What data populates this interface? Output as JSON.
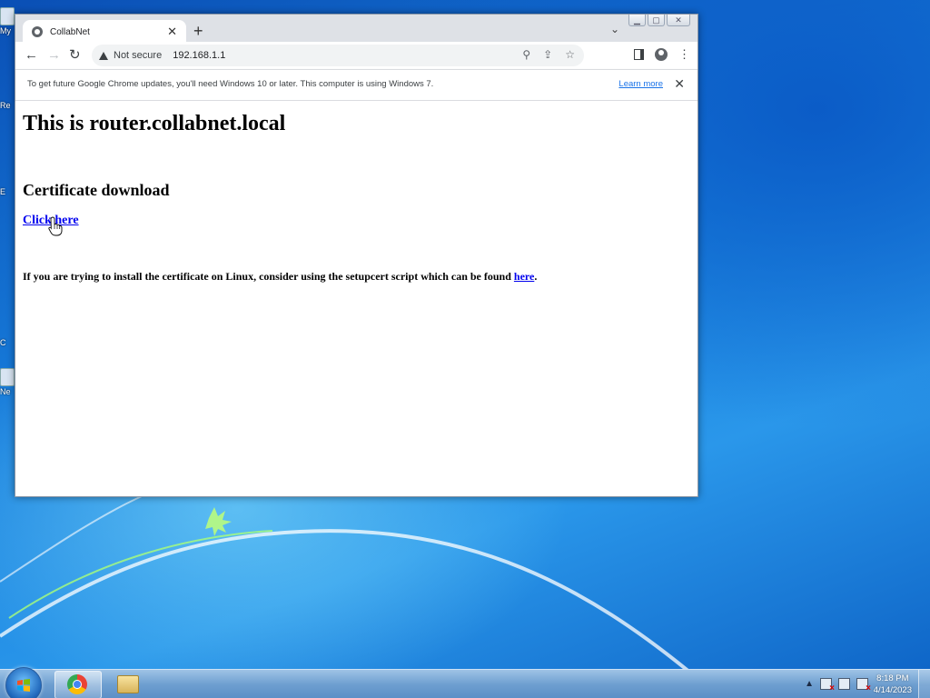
{
  "desktop": {
    "icons": [
      {
        "label": "My"
      },
      {
        "label": "Re"
      },
      {
        "label": "E"
      },
      {
        "label": "C"
      },
      {
        "label": "Ne"
      }
    ]
  },
  "browser": {
    "tab": {
      "title": "CollabNet"
    },
    "address": {
      "security_label": "Not secure",
      "host": "192.168.1.1"
    },
    "infobar": {
      "message": "To get future Google Chrome updates, you'll need Windows 10 or later. This computer is using Windows 7.",
      "learn_more": "Learn more"
    }
  },
  "page": {
    "heading": "This is router.collabnet.local",
    "section_title": "Certificate download",
    "download_link": "Click here",
    "note_text": "If you are trying to install the certificate on Linux, consider using the setupcert script which can be found ",
    "note_link": "here",
    "note_end": "."
  },
  "taskbar": {
    "clock_time": "8:18 PM",
    "clock_date": "4/14/2023"
  },
  "colors": {
    "link": "#0000ee",
    "chrome_tabstrip": "#dee1e6",
    "infobar_link": "#1a73e8"
  }
}
